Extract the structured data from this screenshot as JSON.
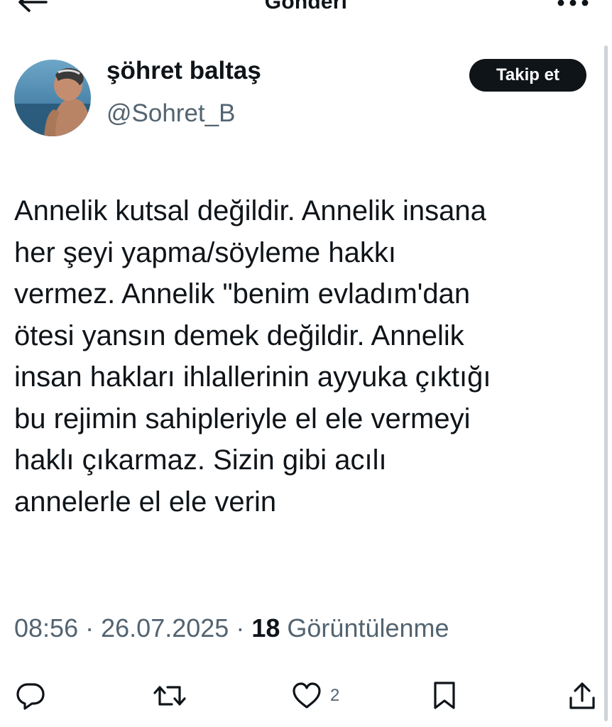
{
  "header": {
    "title": "Gönderi",
    "back_icon": "arrow-left-icon",
    "more_icon": "more-horizontal-icon"
  },
  "author": {
    "display_name": "şöhret baltaş",
    "handle": "@Sohret_B",
    "avatar_icon": "avatar-photo",
    "follow_label": "Takip et"
  },
  "tweet": {
    "lines": [
      "Annelik kutsal değildir. Annelik insana",
      "her şeyi yapma/söyleme hakkı",
      "vermez. Annelik \"benim evladım'dan",
      "ötesi yansın demek değildir. Annelik",
      "insan hakları ihlallerinin ayyuka çıktığı",
      "bu rejimin sahipleriyle el ele vermeyi",
      "haklı çıkarmaz. Sizin gibi acılı",
      "annelerle el ele verin"
    ]
  },
  "meta": {
    "time": "08:56",
    "separator": "·",
    "date": "26.07.2025",
    "views_count": "18",
    "views_label": "Görüntülenme"
  },
  "actions": {
    "reply_icon": "reply-icon",
    "retweet_icon": "retweet-icon",
    "like_icon": "heart-icon",
    "like_count": "2",
    "bookmark_icon": "bookmark-icon",
    "share_icon": "share-icon"
  },
  "colors": {
    "text": "#0f1419",
    "secondary": "#536471",
    "follow_bg": "#0f1419",
    "follow_text": "#ffffff"
  }
}
